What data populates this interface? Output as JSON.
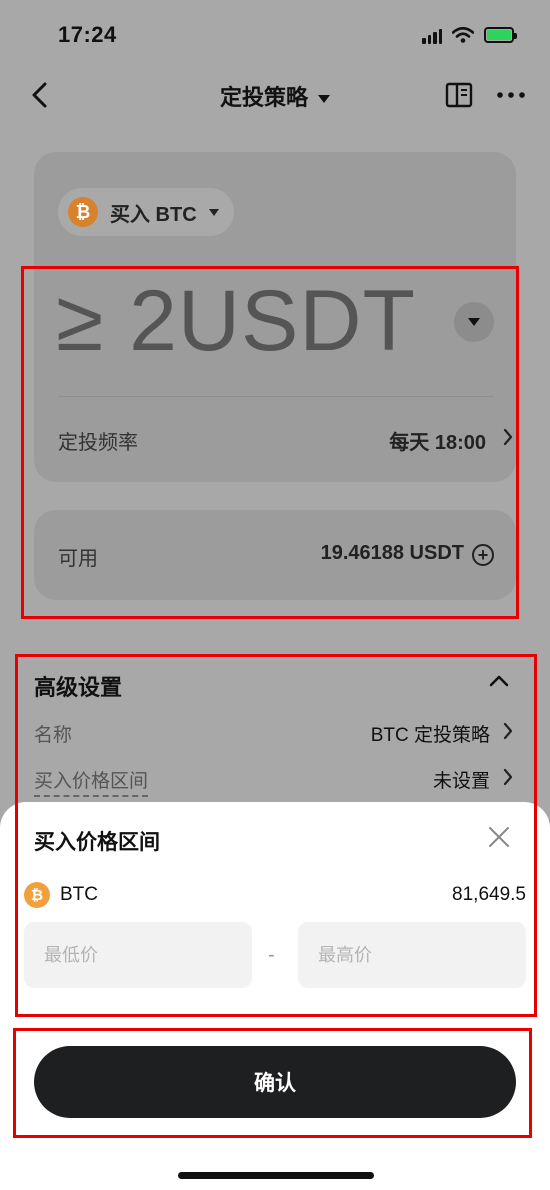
{
  "status_bar": {
    "time": "17:24"
  },
  "nav": {
    "title": "定投策略"
  },
  "asset_selector": {
    "coin_symbol": "₿",
    "label": "买入 BTC"
  },
  "amount": {
    "value": "≥ 2USDT"
  },
  "frequency": {
    "label": "定投频率",
    "value": "每天 18:00"
  },
  "available": {
    "label": "可用",
    "value": "19.46188 USDT"
  },
  "advanced": {
    "title": "高级设置",
    "name_label": "名称",
    "name_value": "BTC 定投策略",
    "price_range_label": "买入价格区间",
    "price_range_value": "未设置"
  },
  "sheet": {
    "title": "买入价格区间",
    "coin": "BTC",
    "price": "81,649.5",
    "min_placeholder": "最低价",
    "separator": "-",
    "max_placeholder": "最高价",
    "confirm_label": "确认"
  },
  "colors": {
    "accent": "#1d1f21",
    "highlight": "#e80000",
    "btc": "#f2a03d"
  }
}
